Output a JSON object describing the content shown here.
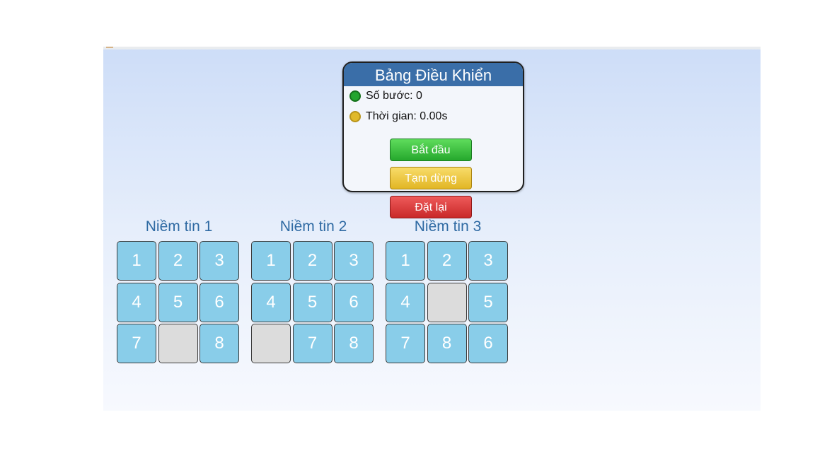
{
  "panel": {
    "title": "Bảng Điều Khiển",
    "steps_label": "Số bước: 0",
    "time_label": "Thời gian: 0.00s",
    "start_label": "Bắt đầu",
    "pause_label": "Tạm dừng",
    "reset_label": "Đặt lại"
  },
  "colors": {
    "header": "#3a6ea8",
    "tile": "#89cde9",
    "empty_tile": "#dcdcdc",
    "start": "#2fb536",
    "pause": "#e8c032",
    "reset": "#d63434",
    "title_text": "#2f6aa3"
  },
  "icons": {
    "steps": "green-circle-icon",
    "time": "yellow-circle-icon"
  },
  "puzzles": [
    {
      "title": "Niềm tin 1",
      "tiles": [
        "1",
        "2",
        "3",
        "4",
        "5",
        "6",
        "7",
        "",
        "8"
      ]
    },
    {
      "title": "Niềm tin 2",
      "tiles": [
        "1",
        "2",
        "3",
        "4",
        "5",
        "6",
        "",
        "7",
        "8"
      ]
    },
    {
      "title": "Niềm tin 3",
      "tiles": [
        "1",
        "2",
        "3",
        "4",
        "",
        "5",
        "7",
        "8",
        "6"
      ]
    }
  ]
}
